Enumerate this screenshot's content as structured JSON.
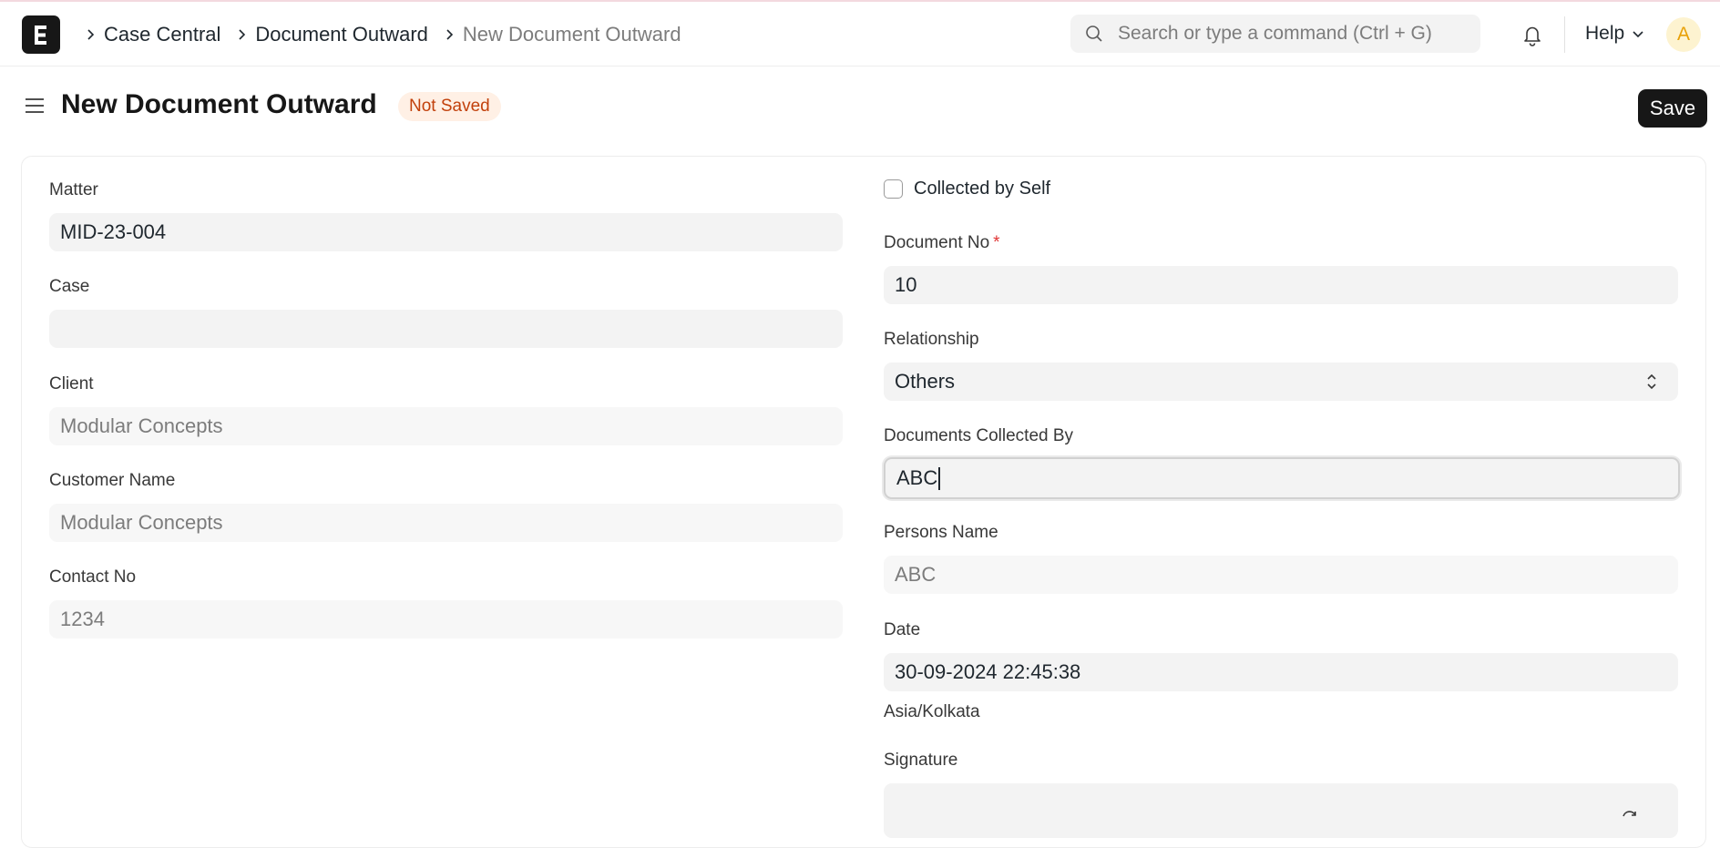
{
  "navbar": {
    "breadcrumbs": [
      "Case Central",
      "Document Outward",
      "New Document Outward"
    ],
    "search_placeholder": "Search or type a command (Ctrl + G)",
    "help_label": "Help",
    "avatar_initial": "A"
  },
  "page": {
    "title": "New Document Outward",
    "status": "Not Saved",
    "save_label": "Save"
  },
  "form": {
    "left": {
      "matter": {
        "label": "Matter",
        "value": "MID-23-004"
      },
      "case": {
        "label": "Case",
        "value": ""
      },
      "client": {
        "label": "Client",
        "value": "Modular Concepts"
      },
      "customer_name": {
        "label": "Customer Name",
        "value": "Modular Concepts"
      },
      "contact_no": {
        "label": "Contact No",
        "value": "1234"
      }
    },
    "right": {
      "collected_by_self": {
        "label": "Collected by Self",
        "checked": false
      },
      "document_no": {
        "label": "Document No",
        "required_mark": "*",
        "value": "10"
      },
      "relationship": {
        "label": "Relationship",
        "value": "Others"
      },
      "documents_collected_by": {
        "label": "Documents Collected By",
        "value": "ABC"
      },
      "persons_name": {
        "label": "Persons Name",
        "value": "ABC"
      },
      "date": {
        "label": "Date",
        "value": "30-09-2024 22:45:38",
        "timezone": "Asia/Kolkata"
      },
      "signature": {
        "label": "Signature"
      }
    }
  },
  "colors": {
    "primary_button": "#171717",
    "badge_bg": "#fff0e5",
    "badge_text": "#c2410c",
    "input_bg": "#f3f3f3"
  },
  "icons": [
    "app-logo-icon",
    "chevron-right-icon",
    "search-icon",
    "bell-icon",
    "chevron-down-icon",
    "hamburger-icon",
    "select-arrows-icon",
    "refresh-icon"
  ]
}
